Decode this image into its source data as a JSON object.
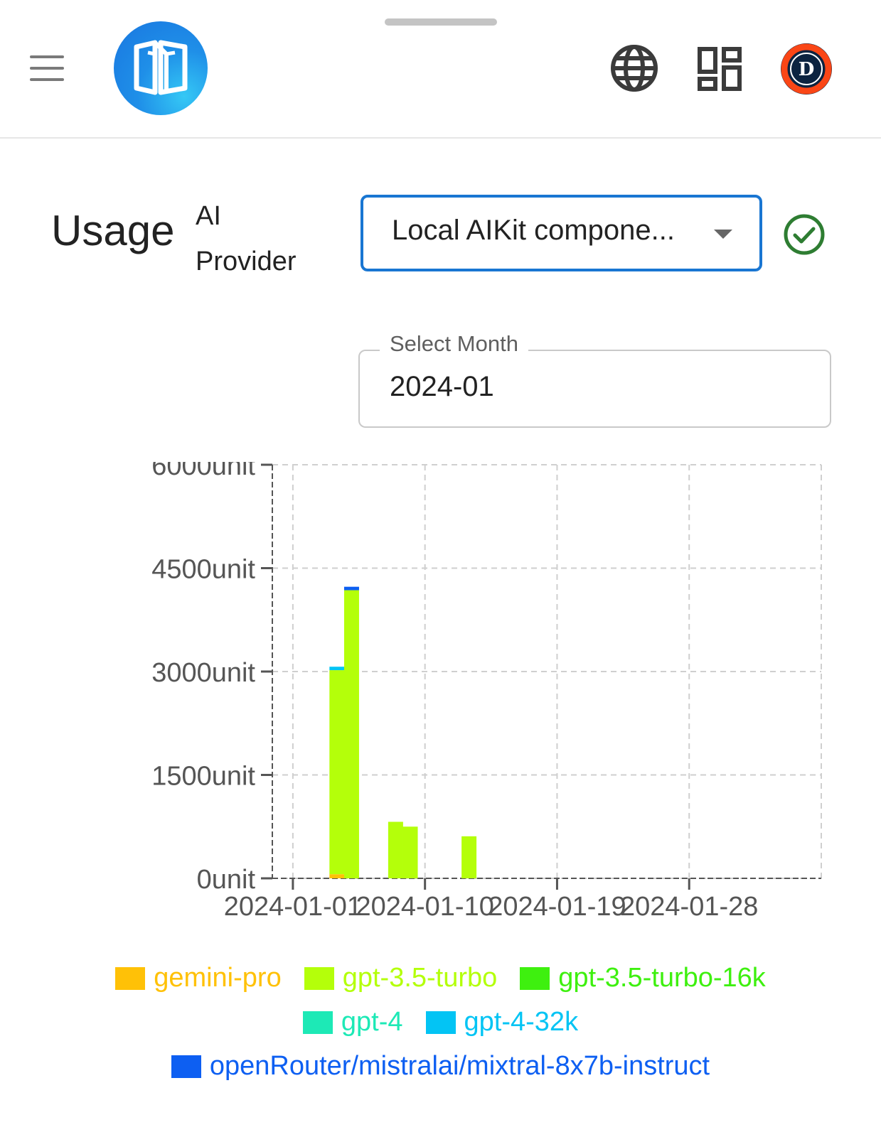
{
  "page": {
    "title": "Usage"
  },
  "header": {
    "menu_icon": "hamburger-menu-icon",
    "logo_icon": "app-logo-icon",
    "actions": [
      "globe-icon",
      "dashboard-icon",
      "profile-avatar-detroit-tigers"
    ]
  },
  "filters": {
    "provider_label": "AI Provider",
    "provider_label_line1": "AI",
    "provider_label_line2": "Provider",
    "provider_value": "Local AIKit compone...",
    "provider_status_icon": "check-circle-icon",
    "month_label": "Select Month",
    "month_value": "2024-01"
  },
  "colors": {
    "primary": "#1976d2",
    "success": "#2e7d32",
    "gemini-pro": "#ffc107",
    "gpt-3.5-turbo": "#b4ff0a",
    "gpt-3.5-turbo-16k": "#3ef00f",
    "gpt-4": "#1de9b6",
    "gpt-4-32k": "#03c4f4",
    "openRouter/mistralai/mixtral-8x7b-instruct": "#0d5ff2"
  },
  "chart_data": {
    "type": "bar",
    "stacked": true,
    "x_type": "date",
    "x": [
      "2024-01-04",
      "2024-01-05",
      "2024-01-08",
      "2024-01-09",
      "2024-01-13"
    ],
    "xticks": [
      "2024-01-01",
      "2024-01-10",
      "2024-01-19",
      "2024-01-28"
    ],
    "yticks": [
      "0unit",
      "1500unit",
      "3000unit",
      "4500unit",
      "6000unit"
    ],
    "ylim": [
      0,
      6000
    ],
    "grid": true,
    "legend_position": "bottom",
    "series": [
      {
        "name": "gemini-pro",
        "values": [
          60,
          0,
          0,
          0,
          0
        ]
      },
      {
        "name": "gpt-3.5-turbo",
        "values": [
          2960,
          4180,
          820,
          750,
          610
        ]
      },
      {
        "name": "gpt-3.5-turbo-16k",
        "values": [
          0,
          0,
          0,
          0,
          0
        ]
      },
      {
        "name": "gpt-4",
        "values": [
          0,
          0,
          0,
          0,
          0
        ]
      },
      {
        "name": "gpt-4-32k",
        "values": [
          50,
          0,
          0,
          0,
          0
        ]
      },
      {
        "name": "openRouter/mistralai/mixtral-8x7b-instruct",
        "values": [
          0,
          50,
          0,
          0,
          0
        ]
      }
    ]
  }
}
